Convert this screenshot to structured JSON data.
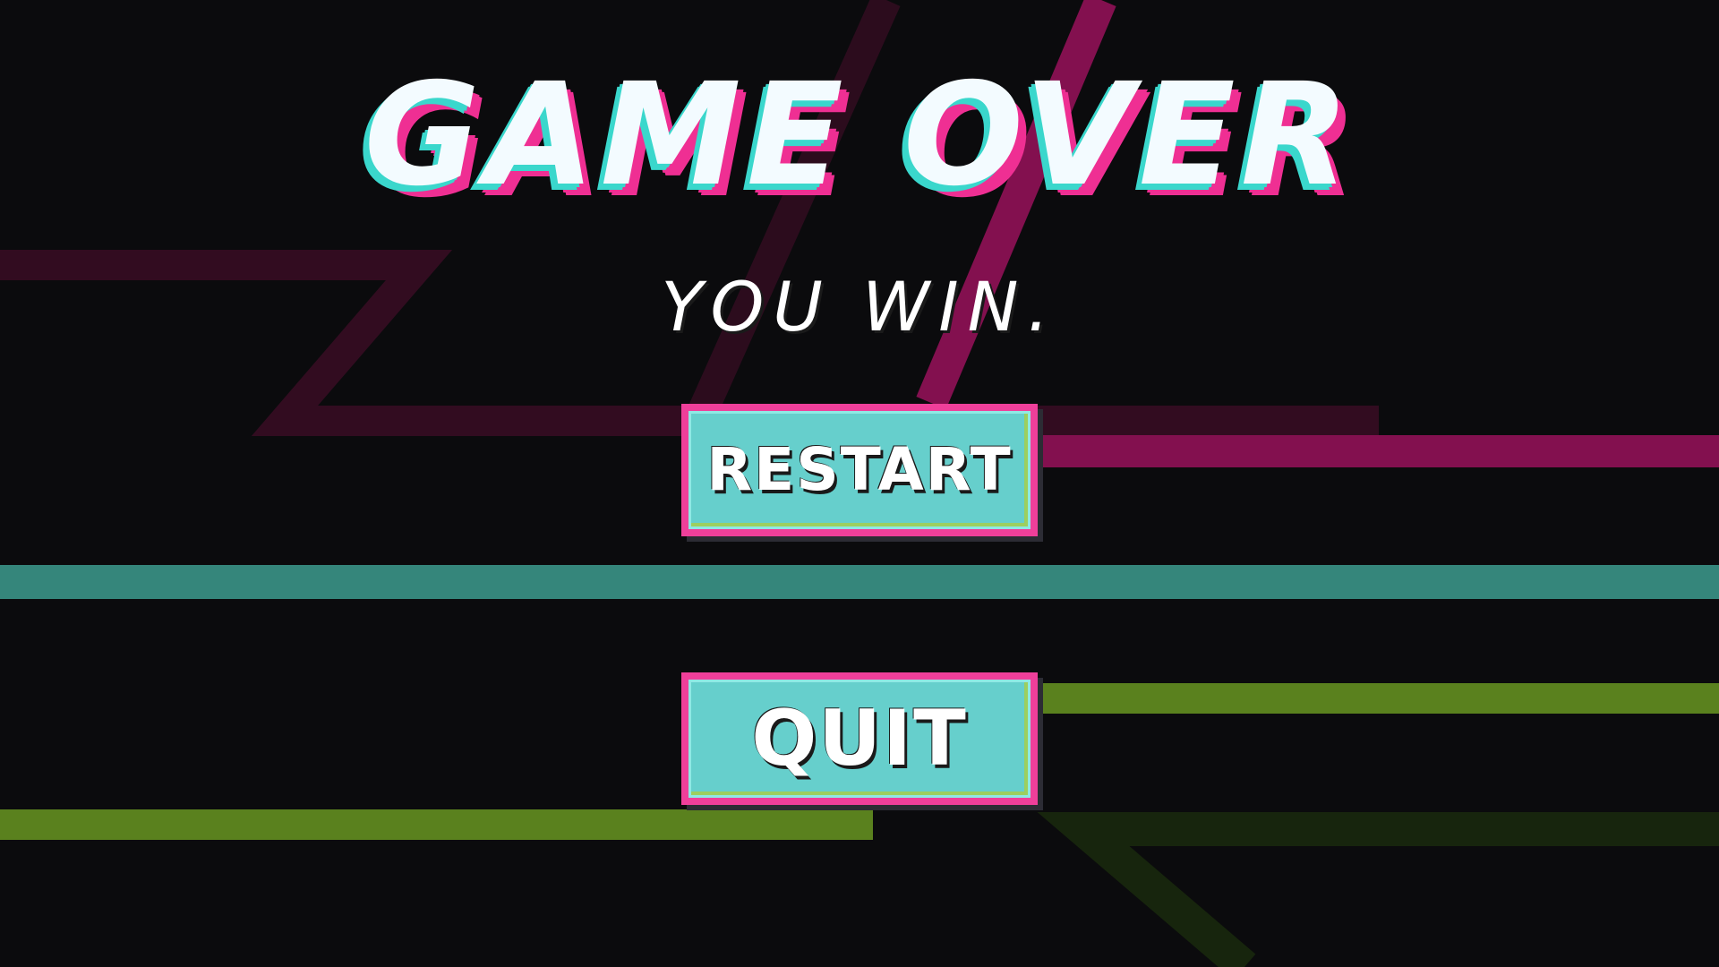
{
  "screen": {
    "title": "GAME OVER",
    "subtitle": "YOU WIN."
  },
  "buttons": {
    "restart_label": "RESTART",
    "quit_label": "QUIT"
  },
  "colors": {
    "background": "#0b0b0d",
    "accent_pink": "#ef3f9a",
    "accent_cyan": "#66cfcc",
    "line_magenta": "#83104f",
    "line_teal": "#35867b",
    "line_green": "#5a811e"
  }
}
